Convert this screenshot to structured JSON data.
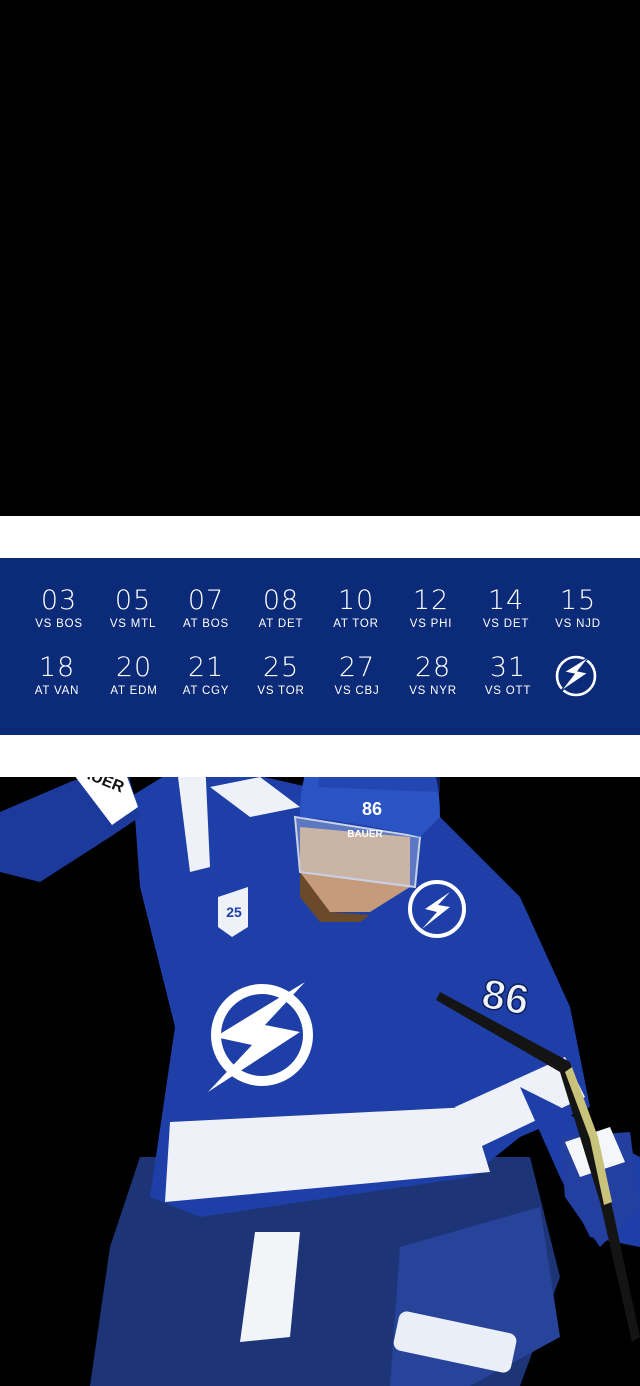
{
  "schedule": {
    "games": [
      {
        "day": "03",
        "opponent": "VS BOS"
      },
      {
        "day": "05",
        "opponent": "VS MTL"
      },
      {
        "day": "07",
        "opponent": "AT BOS"
      },
      {
        "day": "08",
        "opponent": "AT DET"
      },
      {
        "day": "10",
        "opponent": "AT TOR"
      },
      {
        "day": "12",
        "opponent": "VS PHI"
      },
      {
        "day": "14",
        "opponent": "VS DET"
      },
      {
        "day": "15",
        "opponent": "VS NJD"
      },
      {
        "day": "18",
        "opponent": "AT VAN"
      },
      {
        "day": "20",
        "opponent": "AT EDM"
      },
      {
        "day": "21",
        "opponent": "AT CGY"
      },
      {
        "day": "25",
        "opponent": "VS TOR"
      },
      {
        "day": "27",
        "opponent": "VS CBJ"
      },
      {
        "day": "28",
        "opponent": "VS NYR"
      },
      {
        "day": "31",
        "opponent": "VS OTT"
      }
    ]
  },
  "logo_icon": "lightning-bolt-icon",
  "player": {
    "jersey_number": "86",
    "helmet_brand": "BAUER",
    "glove_brand": "BAUER",
    "anniversary_patch": "25"
  },
  "colors": {
    "schedule_bg": "#0b2a78",
    "jersey_blue": "#1f3fa8",
    "stripe": "#ffffff",
    "background": "#000000"
  }
}
